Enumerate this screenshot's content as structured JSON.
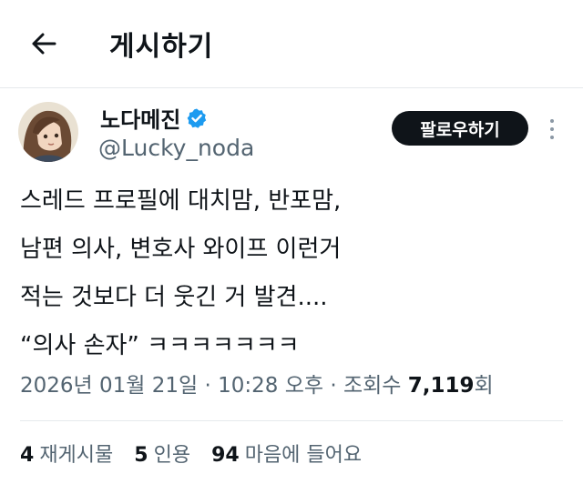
{
  "header": {
    "title": "게시하기",
    "back_icon": "arrow-left-icon"
  },
  "author": {
    "display_name": "노다메진",
    "handle": "@Lucky_noda",
    "verified_badge_color": "#1d9bf0",
    "avatar": "avatar-illustration"
  },
  "follow_button": {
    "label": "팔로우하기"
  },
  "post": {
    "lines": [
      "스레드 프로필에 대치맘, 반포맘,",
      "남편 의사, 변호사 와이프 이런거",
      "적는 것보다 더 웃긴 거 발견....",
      "“의사 손자” ㅋㅋㅋㅋㅋㅋㅋ"
    ]
  },
  "meta": {
    "date": "2026년 01월 21일",
    "sep1": " · ",
    "time": "10:28 오후",
    "sep2": " · ",
    "views_label": "조회수 ",
    "views_count": "7,119",
    "views_unit": "회"
  },
  "stats": {
    "reposts_count": "4",
    "reposts_label": "재게시물",
    "quotes_count": "5",
    "quotes_label": "인용",
    "likes_count": "94",
    "likes_label": "마음에 들어요"
  }
}
